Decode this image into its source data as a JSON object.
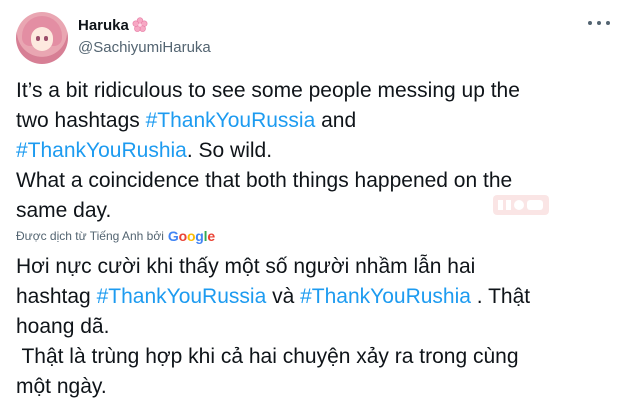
{
  "user": {
    "display_name": "Haruka",
    "emoji_icon": "cherry-blossom-icon",
    "handle": "@SachiyumiHaruka"
  },
  "menu": {
    "icon": "more-options-icon"
  },
  "tweet": {
    "lines": [
      {
        "parts": [
          {
            "text": "It’s a bit ridiculous to see some people messing up the"
          }
        ]
      },
      {
        "parts": [
          {
            "text": "two hashtags "
          },
          {
            "text": "#ThankYouRussia",
            "hashtag": true
          },
          {
            "text": " and"
          }
        ]
      },
      {
        "parts": [
          {
            "text": "#ThankYouRushia",
            "hashtag": true
          },
          {
            "text": ". So wild."
          }
        ]
      },
      {
        "parts": [
          {
            "text": "What a coincidence that both things happened on the"
          }
        ]
      },
      {
        "parts": [
          {
            "text": "same day."
          }
        ]
      }
    ]
  },
  "translation": {
    "label": "Được dịch từ Tiếng Anh bởi",
    "provider": "Google",
    "lines": [
      {
        "parts": [
          {
            "text": "Hơi nực cười khi thấy một số người nhầm lẫn hai"
          }
        ]
      },
      {
        "parts": [
          {
            "text": "hashtag "
          },
          {
            "text": "#ThankYouRussia",
            "hashtag": true
          },
          {
            "text": " và "
          },
          {
            "text": "#ThankYouRushia",
            "hashtag": true
          },
          {
            "text": " . Thật"
          }
        ]
      },
      {
        "parts": [
          {
            "text": "hoang dã."
          }
        ]
      },
      {
        "parts": [
          {
            "text": " Thật là trùng hợp khi cả hai chuyện xảy ra trong cùng"
          }
        ]
      },
      {
        "parts": [
          {
            "text": "một ngày."
          }
        ]
      }
    ]
  },
  "colors": {
    "hashtag": "#1d9bf0",
    "text": "#0f1419",
    "secondary": "#536471"
  }
}
